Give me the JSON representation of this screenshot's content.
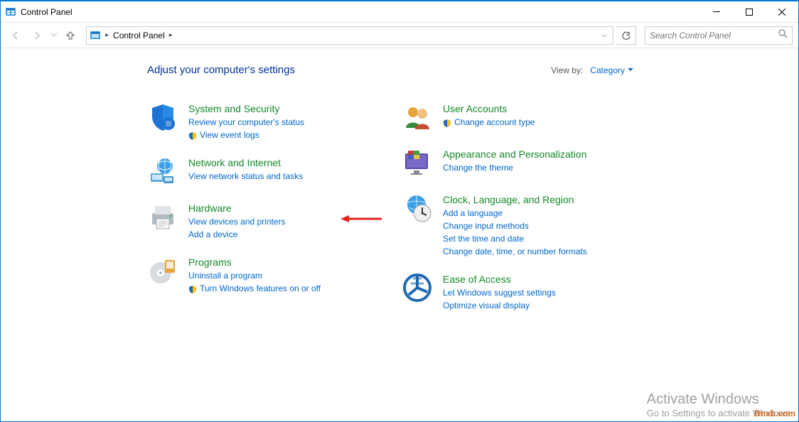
{
  "window": {
    "title": "Control Panel"
  },
  "toolbar": {
    "breadcrumb_root": "Control Panel",
    "search_placeholder": "Search Control Panel"
  },
  "header": {
    "title": "Adjust your computer's settings",
    "view_by_label": "View by:",
    "view_by_value": "Category"
  },
  "categories": {
    "left": [
      {
        "title": "System and Security",
        "links": [
          {
            "label": "Review your computer's status",
            "shield": false
          },
          {
            "label": "View event logs",
            "shield": true
          }
        ]
      },
      {
        "title": "Network and Internet",
        "links": [
          {
            "label": "View network status and tasks",
            "shield": false
          }
        ]
      },
      {
        "title": "Hardware",
        "links": [
          {
            "label": "View devices and printers",
            "shield": false
          },
          {
            "label": "Add a device",
            "shield": false
          }
        ]
      },
      {
        "title": "Programs",
        "links": [
          {
            "label": "Uninstall a program",
            "shield": false
          },
          {
            "label": "Turn Windows features on or off",
            "shield": true
          }
        ]
      }
    ],
    "right": [
      {
        "title": "User Accounts",
        "links": [
          {
            "label": "Change account type",
            "shield": true
          }
        ]
      },
      {
        "title": "Appearance and Personalization",
        "links": [
          {
            "label": "Change the theme",
            "shield": false
          }
        ]
      },
      {
        "title": "Clock, Language, and Region",
        "links": [
          {
            "label": "Add a language",
            "shield": false
          },
          {
            "label": "Change input methods",
            "shield": false
          },
          {
            "label": "Set the time and date",
            "shield": false
          },
          {
            "label": "Change date, time, or number formats",
            "shield": false
          }
        ]
      },
      {
        "title": "Ease of Access",
        "links": [
          {
            "label": "Let Windows suggest settings",
            "shield": false
          },
          {
            "label": "Optimize visual display",
            "shield": false
          }
        ]
      }
    ]
  },
  "watermark": {
    "title": "Activate Windows",
    "subtitle": "Go to Settings to activate Windows.",
    "brand": "Bnxb.com"
  }
}
